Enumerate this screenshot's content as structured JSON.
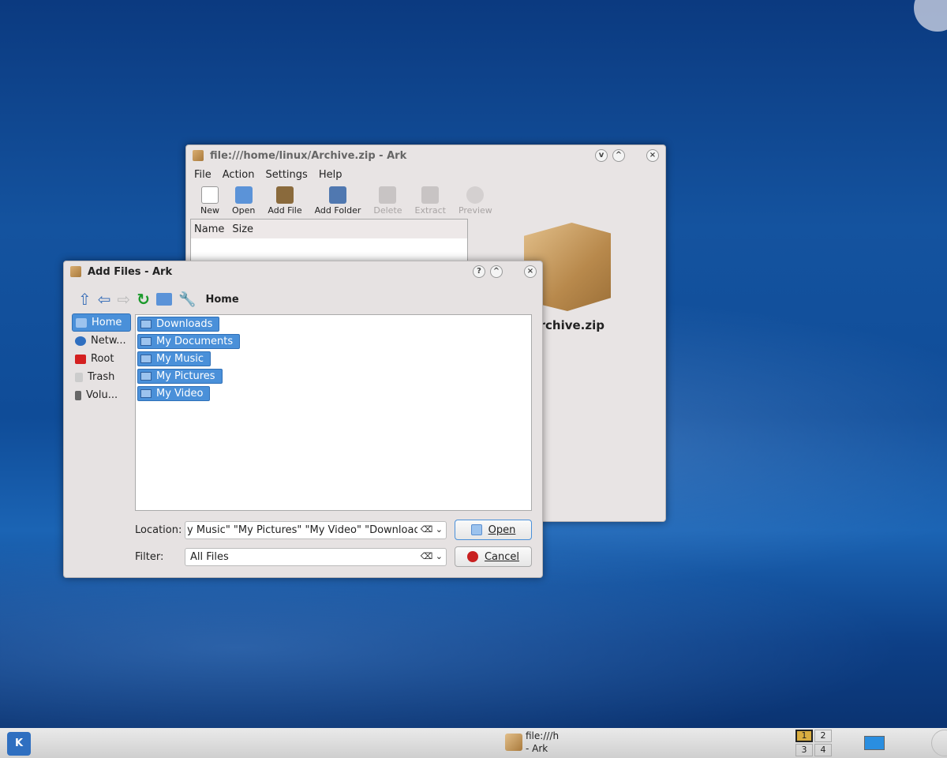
{
  "ark": {
    "title": "file:///home/linux/Archive.zip - Ark",
    "menu": [
      "File",
      "Action",
      "Settings",
      "Help"
    ],
    "toolbar": [
      {
        "label": "New",
        "enabled": true,
        "icon": "new-icon"
      },
      {
        "label": "Open",
        "enabled": true,
        "icon": "open-icon"
      },
      {
        "label": "Add File",
        "enabled": true,
        "icon": "add-file-icon"
      },
      {
        "label": "Add Folder",
        "enabled": true,
        "icon": "add-folder-icon"
      },
      {
        "label": "Delete",
        "enabled": false,
        "icon": "delete-icon"
      },
      {
        "label": "Extract",
        "enabled": false,
        "icon": "extract-icon"
      },
      {
        "label": "Preview",
        "enabled": false,
        "icon": "preview-icon"
      }
    ],
    "columns": [
      "Name",
      "Size"
    ],
    "archive_name": "Archive.zip"
  },
  "dialog": {
    "title": "Add Files - Ark",
    "path": "Home",
    "places": [
      {
        "label": "Home",
        "selected": true,
        "color": "#5b8fd0"
      },
      {
        "label": "Netw...",
        "color": "#2f6fc0"
      },
      {
        "label": "Root",
        "color": "#d42020"
      },
      {
        "label": "Trash",
        "color": "#bbbbbb"
      },
      {
        "label": "Volu...",
        "color": "#666666"
      }
    ],
    "files": [
      "Downloads",
      "My Documents",
      "My Music",
      "My Pictures",
      "My Video"
    ],
    "location_label": "Location:",
    "location_value": "y Music\" \"My Pictures\" \"My Video\" \"Downloads\"",
    "filter_label": "Filter:",
    "filter_value": "All Files",
    "open_label": "Open",
    "cancel_label": "Cancel"
  },
  "taskbar": {
    "task_line1": "file:///h",
    "task_line2": "- Ark",
    "desktops": [
      "1",
      "2",
      "3",
      "4"
    ]
  },
  "colors": {
    "selection": "#4a90d9"
  }
}
